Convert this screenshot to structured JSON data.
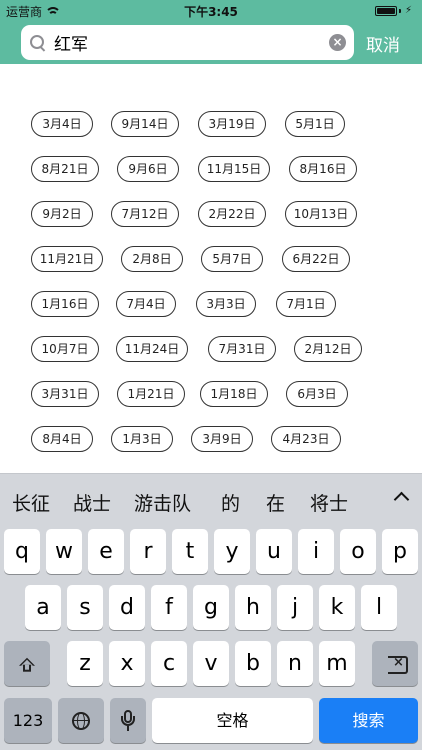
{
  "status": {
    "carrier": "运营商",
    "time": "下午3:45"
  },
  "search": {
    "value": "红军",
    "cancel_label": "取消"
  },
  "date_tags": [
    [
      "3月4日",
      "9月14日",
      "3月19日",
      "5月1日"
    ],
    [
      "8月21日",
      "9月6日",
      "11月15日",
      "8月16日"
    ],
    [
      "9月2日",
      "7月12日",
      "2月22日",
      "10月13日"
    ],
    [
      "11月21日",
      "2月8日",
      "5月7日",
      "6月22日"
    ],
    [
      "1月16日",
      "7月4日",
      "3月3日",
      "7月1日"
    ],
    [
      "10月7日",
      "11月24日",
      "7月31日",
      "2月12日"
    ],
    [
      "3月31日",
      "1月21日",
      "1月18日",
      "6月3日"
    ],
    [
      "8月4日",
      "1月3日",
      "3月9日",
      "4月23日"
    ]
  ],
  "keyboard": {
    "suggestions": [
      "长征",
      "战士",
      "游击队",
      "的",
      "在",
      "将士"
    ],
    "row1": [
      "q",
      "w",
      "e",
      "r",
      "t",
      "y",
      "u",
      "i",
      "o",
      "p"
    ],
    "row2": [
      "a",
      "s",
      "d",
      "f",
      "g",
      "h",
      "j",
      "k",
      "l"
    ],
    "row3": [
      "z",
      "x",
      "c",
      "v",
      "b",
      "n",
      "m"
    ],
    "numbers_label": "123",
    "space_label": "空格",
    "search_label": "搜索"
  }
}
